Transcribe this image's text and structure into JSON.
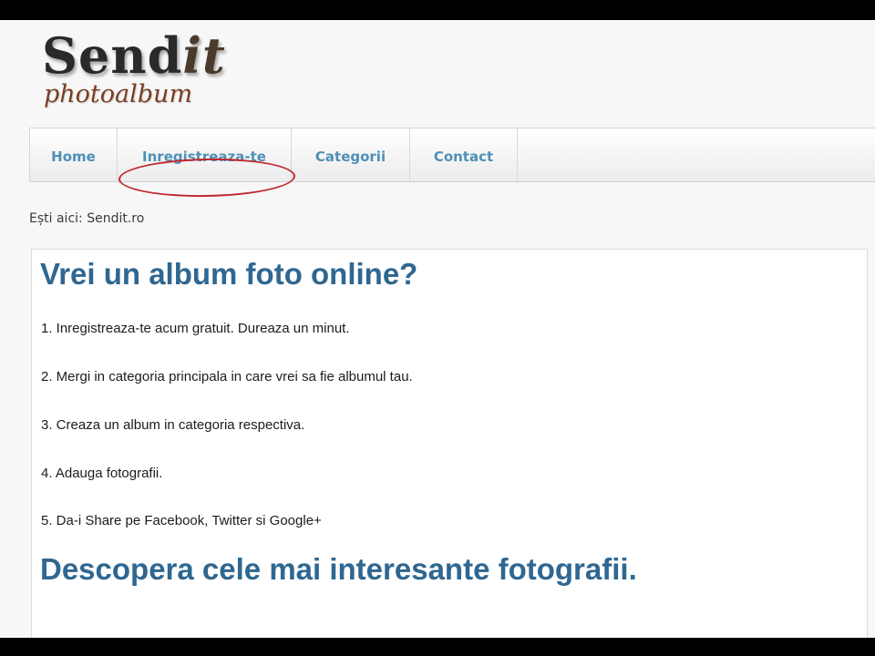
{
  "logo": {
    "main_prefix": "Send",
    "main_suffix": "it",
    "sub": "photoalbum"
  },
  "nav": {
    "items": [
      {
        "label": "Home"
      },
      {
        "label": "Inregistreaza-te"
      },
      {
        "label": "Categorii"
      },
      {
        "label": "Contact"
      }
    ]
  },
  "breadcrumb": {
    "text": "Ești aici: Sendit.ro"
  },
  "content": {
    "heading_1": "Vrei un album foto online?",
    "steps": [
      "1. Inregistreaza-te acum gratuit. Dureaza un minut.",
      "2. Mergi in categoria principala in care vrei sa fie albumul tau.",
      "3. Creaza un album in categoria respectiva.",
      "4. Adauga fotografii.",
      "5. Da-i Share pe Facebook, Twitter si Google+"
    ],
    "heading_2": "Descopera cele mai interesante fotografii."
  },
  "colors": {
    "nav_link": "#4f8fb5",
    "heading": "#2f6791",
    "highlight_ring": "#c0282f"
  }
}
